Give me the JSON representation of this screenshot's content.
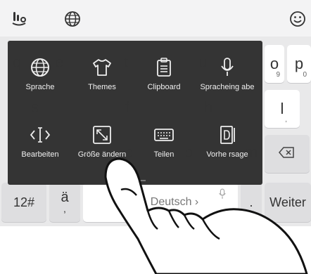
{
  "topbar": {
    "icons": [
      "swipe-typing-icon",
      "globe-icon",
      "emoji-icon"
    ]
  },
  "keys": {
    "o_label": "o",
    "o_sub": "9",
    "p_label": "p",
    "p_sub": "0",
    "l_label": "l",
    "l_sub": ",",
    "backspace_icon": "backspace-icon",
    "numbers_label": "12#",
    "a_umlaut_label": "ä",
    "a_umlaut_sub": ",",
    "space_label": "Deutsch ›",
    "mic_icon": "microphone-icon",
    "period_label": ".",
    "enter_label": "Weiter"
  },
  "menu": {
    "items": [
      {
        "label": "Sprache",
        "icon": "globe-icon"
      },
      {
        "label": "Themes",
        "icon": "tshirt-icon"
      },
      {
        "label": "Clipboard",
        "icon": "clipboard-icon"
      },
      {
        "label": "Spracheing abe",
        "icon": "microphone-icon"
      },
      {
        "label": "Bearbeiten",
        "icon": "text-cursor-icon"
      },
      {
        "label": "Größe ändern",
        "icon": "resize-icon"
      },
      {
        "label": "Teilen",
        "icon": "keyboard-split-icon"
      },
      {
        "label": "Vorhe rsage",
        "icon": "prediction-icon"
      }
    ]
  }
}
